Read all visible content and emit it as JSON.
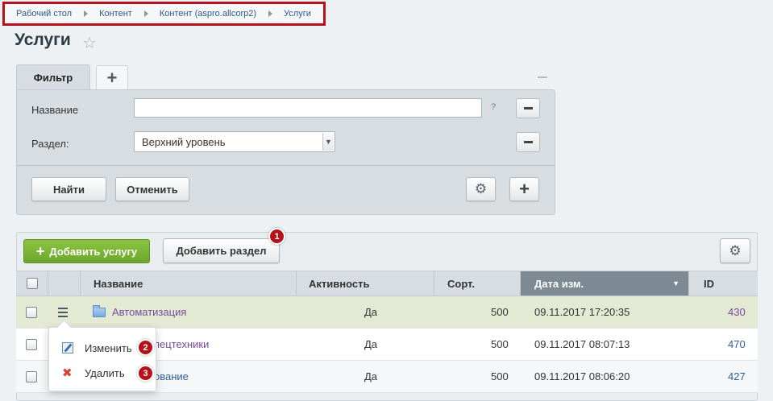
{
  "breadcrumb": [
    "Рабочий стол",
    "Контент",
    "Контент (aspro.allcorp2)",
    "Услуги"
  ],
  "page": {
    "title": "Услуги"
  },
  "filter": {
    "tab_label": "Фильтр",
    "fields": {
      "name_label": "Название",
      "name_value": "",
      "section_label": "Раздел:",
      "section_value": "Верхний уровень"
    },
    "help_mark": "?",
    "buttons": {
      "find": "Найти",
      "cancel": "Отменить"
    }
  },
  "toolbar": {
    "add_service": "Добавить услугу",
    "add_section": "Добавить раздел"
  },
  "table": {
    "columns": {
      "name": "Название",
      "active": "Активность",
      "sort": "Сорт.",
      "date": "Дата изм.",
      "id": "ID"
    },
    "rows": [
      {
        "name": "Автоматизация",
        "active": "Да",
        "sort": "500",
        "date": "09.11.2017 17:20:35",
        "id": "430"
      },
      {
        "name": "пецтехники",
        "active": "Да",
        "sort": "500",
        "date": "09.11.2017 08:07:13",
        "id": "470"
      },
      {
        "name": "ование",
        "active": "Да",
        "sort": "500",
        "date": "09.11.2017 08:06:20",
        "id": "427"
      }
    ]
  },
  "context_menu": {
    "edit": "Изменить",
    "delete": "Удалить"
  },
  "badges": [
    "1",
    "2",
    "3"
  ],
  "colors": {
    "accent_red": "#b5121b",
    "add_button_green": "#7ab536",
    "selected_row": "#e3e9d3",
    "sorted_header": "#7d8a94"
  }
}
